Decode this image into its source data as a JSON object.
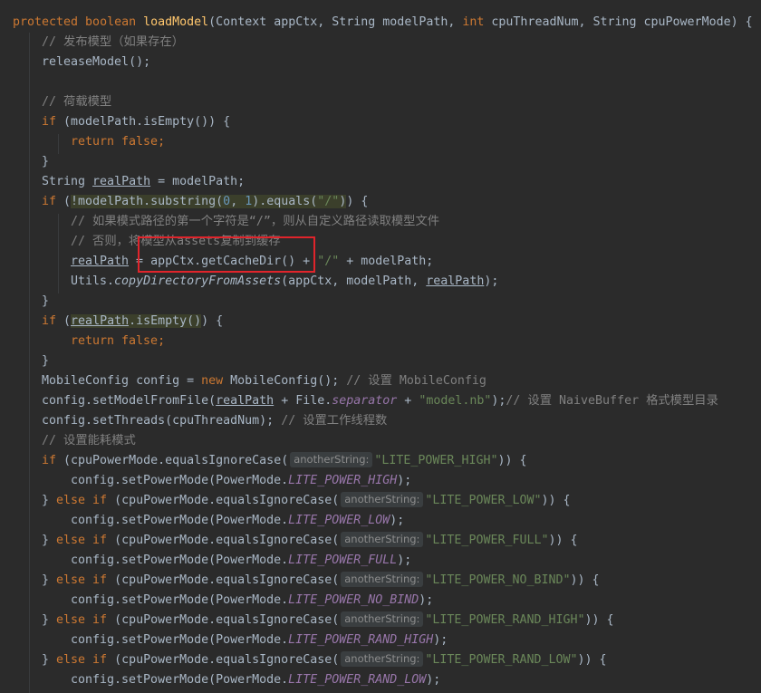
{
  "hl_color": "#e0242b",
  "code": {
    "l1": {
      "t1": "protected boolean ",
      "t2": "loadModel",
      "t3": "(Context appCtx, String modelPath, ",
      "t4": "int ",
      "t5": "cpuThreadNum, String cpuPowerMode) {"
    },
    "l2": {
      "t1": "// 发布模型（如果存在）"
    },
    "l3": {
      "t1": "releaseModel();"
    },
    "l5": {
      "t1": "// 荷载模型"
    },
    "l6": {
      "t1": "if ",
      "t2": "(modelPath.isEmpty()) {"
    },
    "l7": {
      "t1": "return false;"
    },
    "l8": {
      "t1": "}"
    },
    "l9": {
      "t1": "String ",
      "t2": "realPath",
      "t3": " = modelPath;"
    },
    "l10": {
      "t1": "if ",
      "t2": "(",
      "t3": "!modelPath.substring(",
      "t4": "0",
      "t5": ", ",
      "t6": "1",
      "t7": ").equals(",
      "t8": "\"/\"",
      "t9": ")",
      "t10": ") {"
    },
    "l11": {
      "t1": "// 如果模式路径的第一个字符是“/”，则从自定义路径读取模型文件"
    },
    "l12": {
      "t1": "// 否则，将模型从assets复制到缓存"
    },
    "l13": {
      "t1": "realPath",
      "t2": " = appCtx.getCacheDir() + ",
      "t3": "\"/\"",
      "t4": " + modelPath;"
    },
    "l14": {
      "t1": "Utils.",
      "t2": "copyDirectoryFromAssets",
      "t3": "(appCtx, modelPath, ",
      "t4": "realPath",
      "t5": ");"
    },
    "l15": {
      "t1": "}"
    },
    "l16": {
      "t1": "if ",
      "t2": "(",
      "t3": "realPath",
      "t4": ".isEmpty()",
      "t5": ") {"
    },
    "l17": {
      "t1": "return false;"
    },
    "l18": {
      "t1": "}"
    },
    "l19": {
      "t1": "MobileConfig config = ",
      "t2": "new ",
      "t3": "MobileConfig(); ",
      "t4": "// 设置 MobileConfig"
    },
    "l20": {
      "t1": "config.setModelFromFile(",
      "t2": "realPath",
      "t3": " + File.",
      "t4": "separator",
      "t5": " + ",
      "t6": "\"model.nb\"",
      "t7": ");",
      "t8": "// 设置 NaiveBuffer 格式模型目录"
    },
    "l21": {
      "t1": "config.setThreads(cpuThreadNum); ",
      "t2": "// 设置工作线程数"
    },
    "l22": {
      "t1": "// 设置能耗模式"
    },
    "l23": {
      "t1": "if ",
      "t2": "(cpuPowerMode.equalsIgnoreCase(",
      "hint": "anotherString:",
      "t3": "\"LITE_POWER_HIGH\"",
      "t4": ")) {"
    },
    "l24": {
      "t1": "config.setPowerMode(PowerMode.",
      "t2": "LITE_POWER_HIGH",
      "t3": ");"
    },
    "l25": {
      "t1": "} ",
      "t2": "else if ",
      "t3": "(cpuPowerMode.equalsIgnoreCase(",
      "hint": "anotherString:",
      "t4": "\"LITE_POWER_LOW\"",
      "t5": ")) {"
    },
    "l26": {
      "t1": "config.setPowerMode(PowerMode.",
      "t2": "LITE_POWER_LOW",
      "t3": ");"
    },
    "l27": {
      "t1": "} ",
      "t2": "else if ",
      "t3": "(cpuPowerMode.equalsIgnoreCase(",
      "hint": "anotherString:",
      "t4": "\"LITE_POWER_FULL\"",
      "t5": ")) {"
    },
    "l28": {
      "t1": "config.setPowerMode(PowerMode.",
      "t2": "LITE_POWER_FULL",
      "t3": ");"
    },
    "l29": {
      "t1": "} ",
      "t2": "else if ",
      "t3": "(cpuPowerMode.equalsIgnoreCase(",
      "hint": "anotherString:",
      "t4": "\"LITE_POWER_NO_BIND\"",
      "t5": ")) {"
    },
    "l30": {
      "t1": "config.setPowerMode(PowerMode.",
      "t2": "LITE_POWER_NO_BIND",
      "t3": ");"
    },
    "l31": {
      "t1": "} ",
      "t2": "else if ",
      "t3": "(cpuPowerMode.equalsIgnoreCase(",
      "hint": "anotherString:",
      "t4": "\"LITE_POWER_RAND_HIGH\"",
      "t5": ")) {"
    },
    "l32": {
      "t1": "config.setPowerMode(PowerMode.",
      "t2": "LITE_POWER_RAND_HIGH",
      "t3": ");"
    },
    "l33": {
      "t1": "} ",
      "t2": "else if ",
      "t3": "(cpuPowerMode.equalsIgnoreCase(",
      "hint": "anotherString:",
      "t4": "\"LITE_POWER_RAND_LOW\"",
      "t5": ")) {"
    },
    "l34": {
      "t1": "config.setPowerMode(PowerMode.",
      "t2": "LITE_POWER_RAND_LOW",
      "t3": ");"
    }
  }
}
